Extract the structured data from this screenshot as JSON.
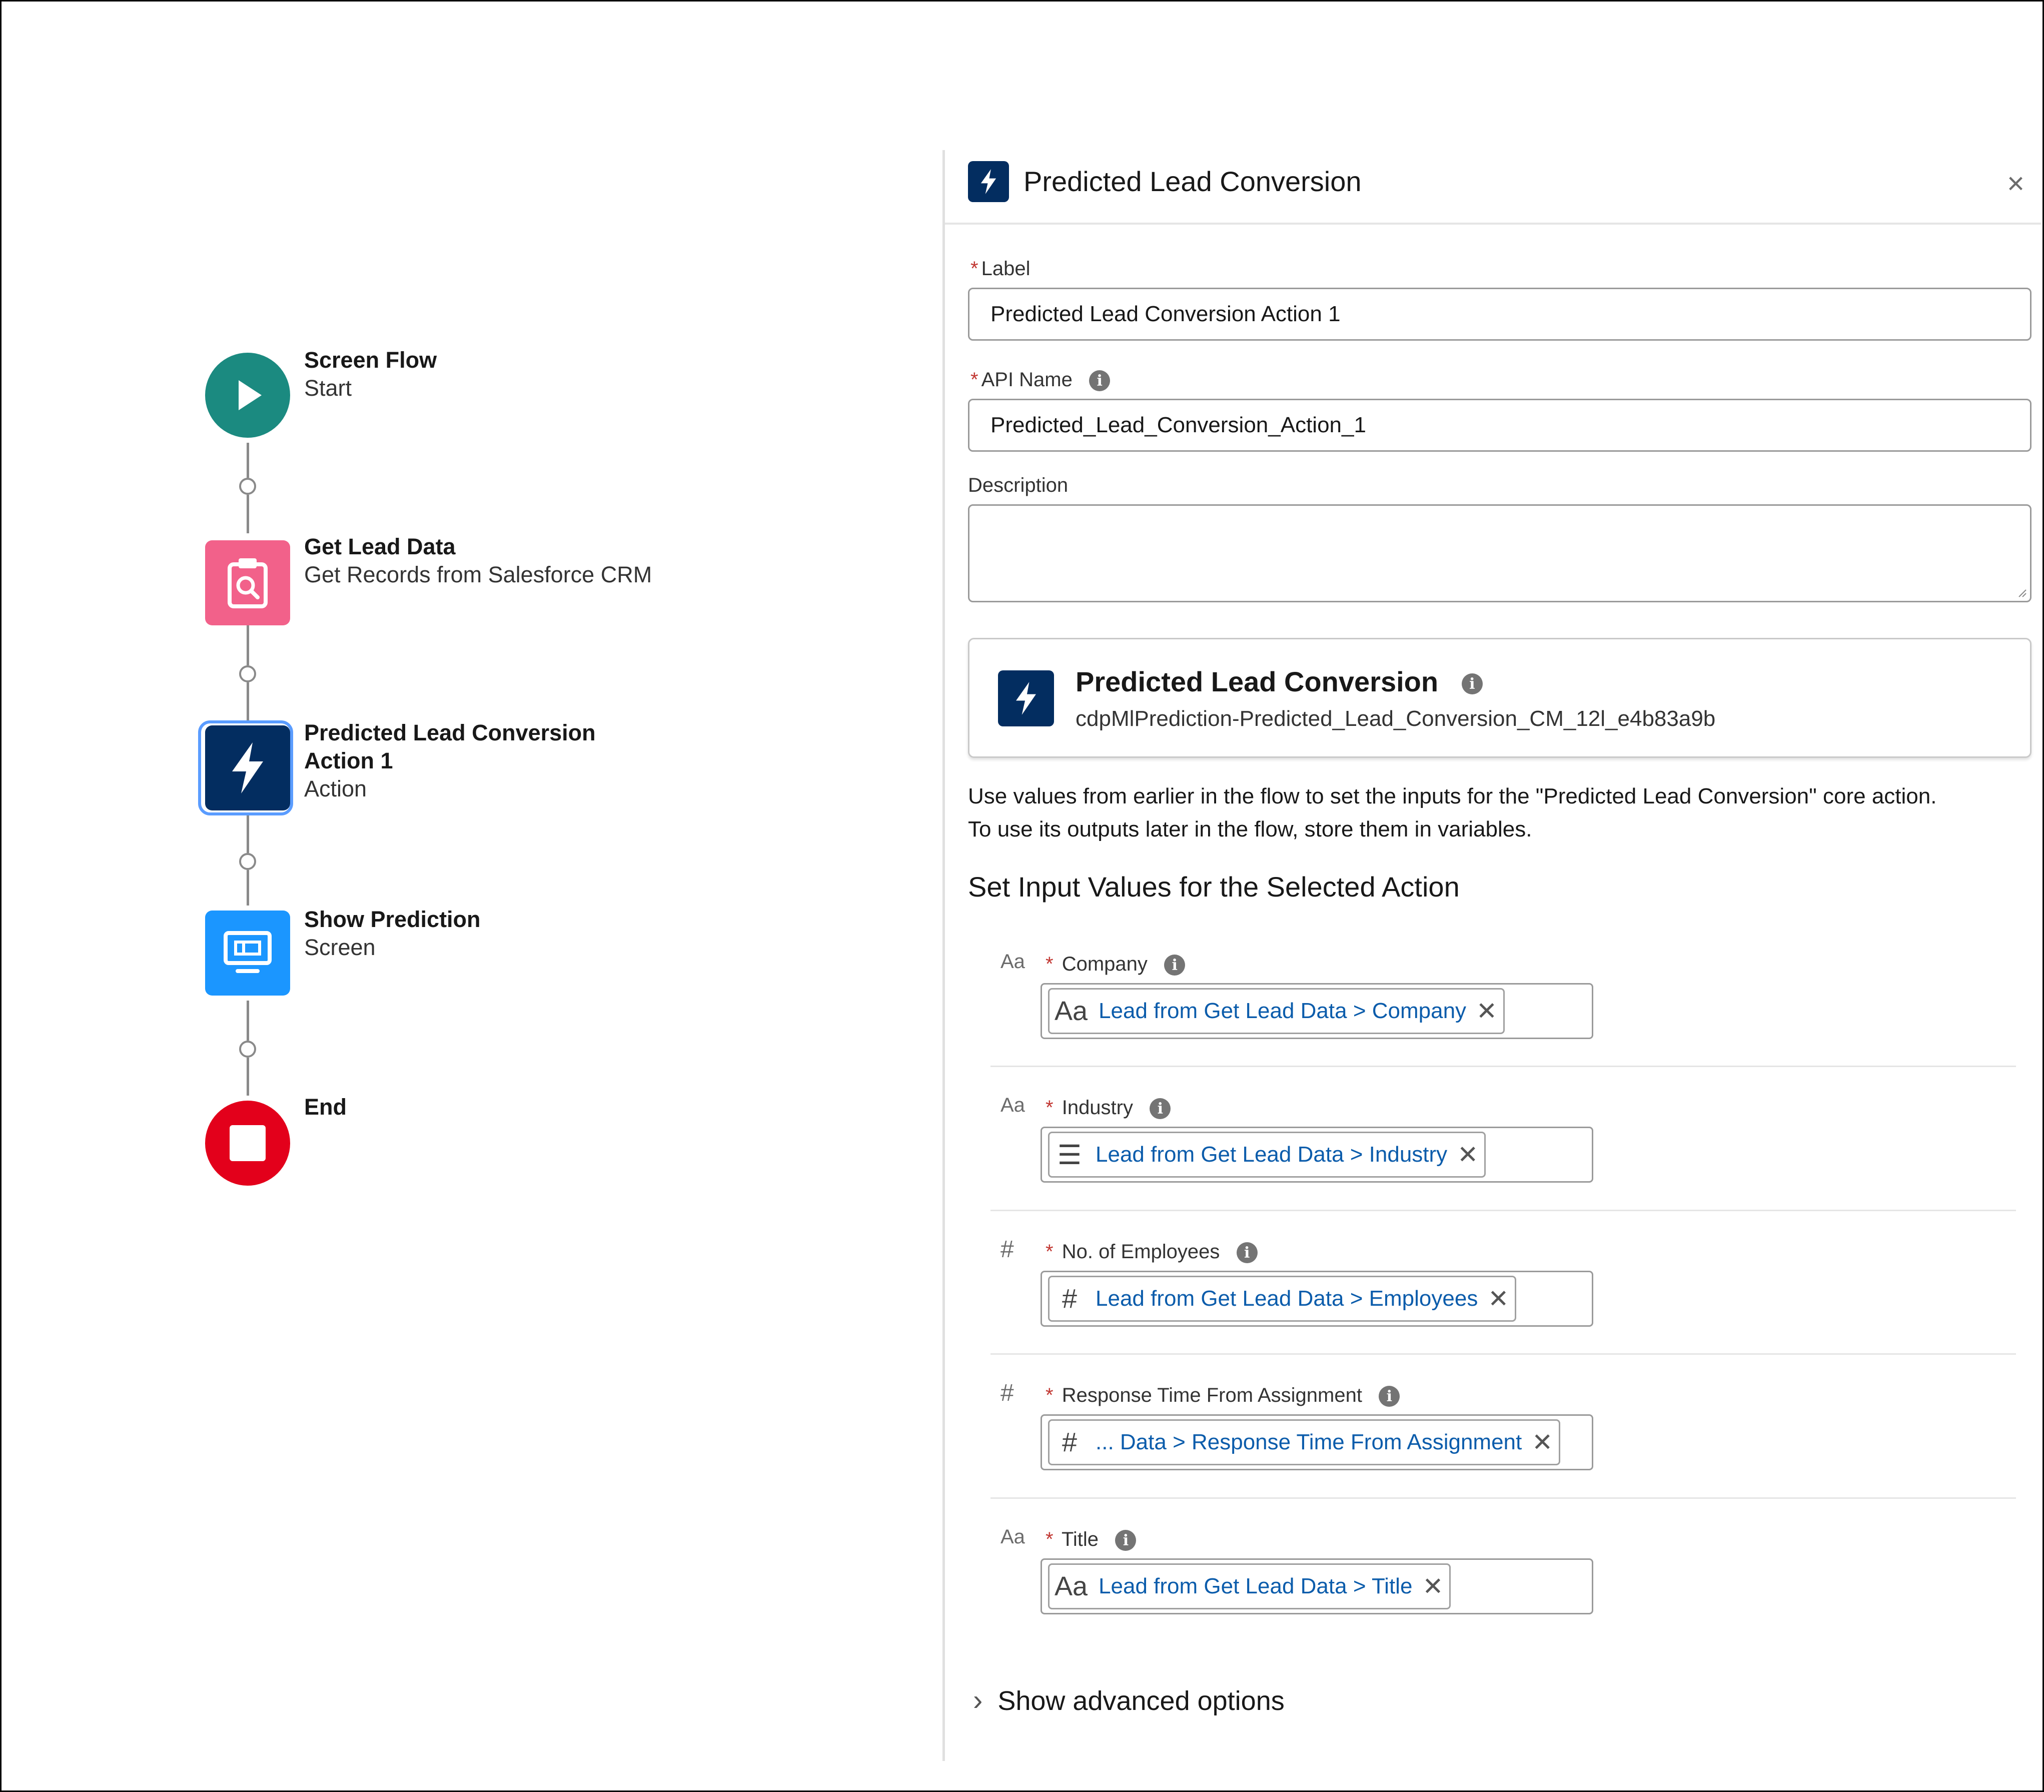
{
  "flow": {
    "nodes": [
      {
        "title": "Screen Flow",
        "subtitle": "Start"
      },
      {
        "title": "Get Lead Data",
        "subtitle": "Get Records from Salesforce CRM"
      },
      {
        "title_line1": "Predicted Lead Conversion",
        "title_line2": "Action 1",
        "subtitle": "Action"
      },
      {
        "title": "Show Prediction",
        "subtitle": "Screen"
      },
      {
        "title": "End"
      }
    ]
  },
  "panel": {
    "title": "Predicted Lead Conversion",
    "close": "×",
    "label_field": {
      "label": "Label",
      "value": "Predicted Lead Conversion Action 1"
    },
    "api_field": {
      "label": "API Name",
      "value": "Predicted_Lead_Conversion_Action_1"
    },
    "description_field": {
      "label": "Description",
      "value": ""
    },
    "action_card": {
      "title": "Predicted Lead Conversion",
      "api_name": "cdpMlPrediction-Predicted_Lead_Conversion_CM_12l_e4b83a9b"
    },
    "help_line1": "Use values from earlier in the flow to set the inputs for the \"Predicted Lead Conversion\" core action.",
    "help_line2": "To use its outputs later in the flow, store them in variables.",
    "section_title": "Set Input Values for the Selected Action",
    "inputs": [
      {
        "type_icon": "Aa",
        "label": "Company",
        "pill_icon": "Aa",
        "value": "Lead from Get Lead Data > Company"
      },
      {
        "type_icon": "Aa",
        "label": "Industry",
        "pill_icon": "☰",
        "value": "Lead from Get Lead Data > Industry"
      },
      {
        "type_icon": "#",
        "label": "No. of Employees",
        "pill_icon": "#",
        "value": "Lead from Get Lead Data > Employees"
      },
      {
        "type_icon": "#",
        "label": "Response Time From Assignment",
        "pill_icon": "#",
        "value": "... Data > Response Time From Assignment"
      },
      {
        "type_icon": "Aa",
        "label": "Title",
        "pill_icon": "Aa",
        "value": "Lead from Get Lead Data > Title"
      }
    ],
    "advanced": "Show advanced options"
  },
  "colors": {
    "start": "#1b8a80",
    "get_records": "#f2618a",
    "action": "#032d60",
    "screen": "#1b96ff",
    "end": "#e3001b",
    "link": "#0b5cab"
  }
}
